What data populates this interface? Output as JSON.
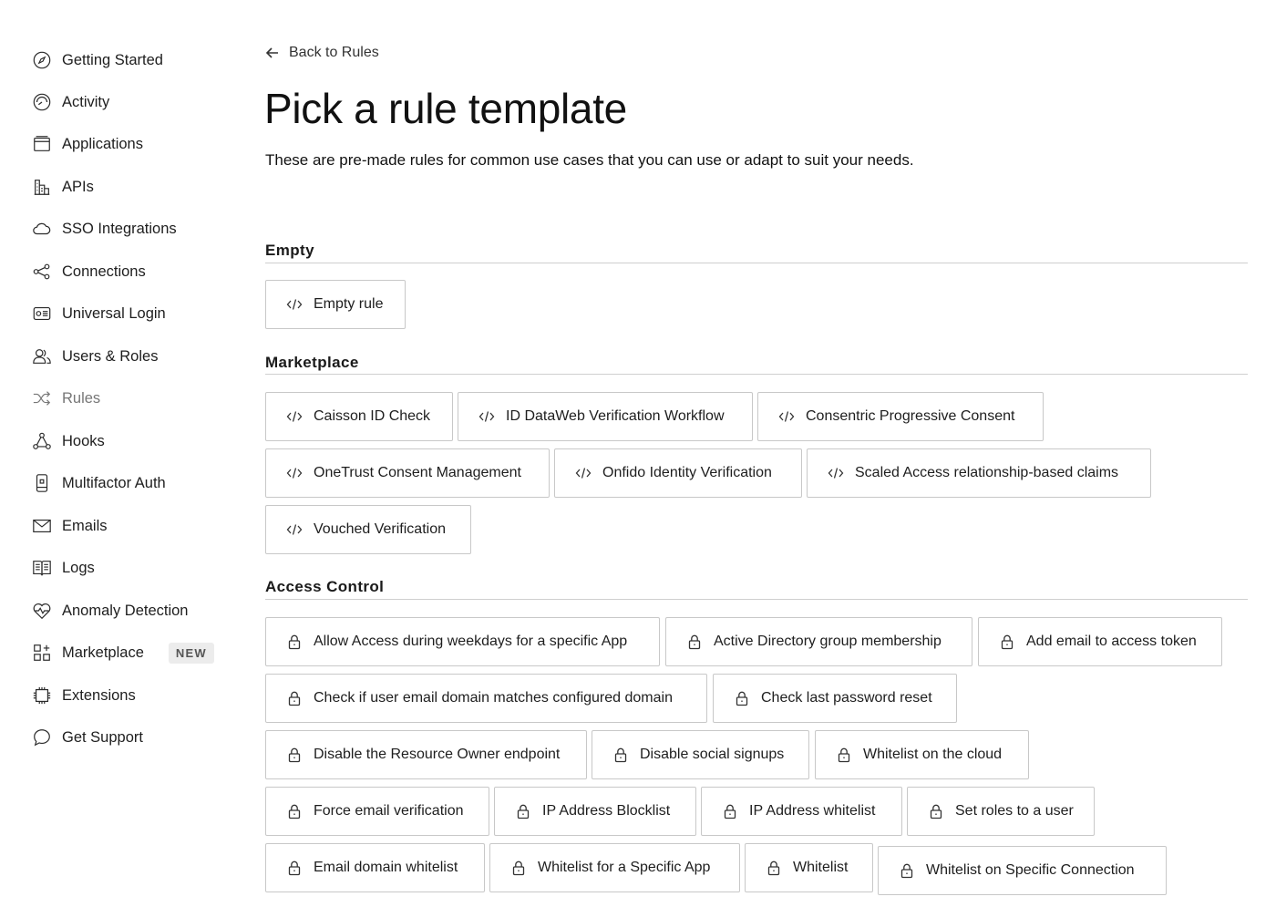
{
  "sidebar": {
    "items": [
      {
        "label": "Getting Started",
        "icon": "compass-icon"
      },
      {
        "label": "Activity",
        "icon": "activity-icon"
      },
      {
        "label": "Applications",
        "icon": "applications-icon"
      },
      {
        "label": "APIs",
        "icon": "apis-icon"
      },
      {
        "label": "SSO Integrations",
        "icon": "cloud-icon"
      },
      {
        "label": "Connections",
        "icon": "connections-icon"
      },
      {
        "label": "Universal Login",
        "icon": "universal-login-icon"
      },
      {
        "label": "Users & Roles",
        "icon": "users-icon"
      },
      {
        "label": "Rules",
        "icon": "shuffle-icon",
        "active": true
      },
      {
        "label": "Hooks",
        "icon": "hooks-icon"
      },
      {
        "label": "Multifactor Auth",
        "icon": "phone-icon"
      },
      {
        "label": "Emails",
        "icon": "mail-icon"
      },
      {
        "label": "Logs",
        "icon": "book-icon"
      },
      {
        "label": "Anomaly Detection",
        "icon": "heart-pulse-icon"
      },
      {
        "label": "Marketplace",
        "icon": "grid-icon",
        "badge": "NEW"
      },
      {
        "label": "Extensions",
        "icon": "chip-icon"
      },
      {
        "label": "Get Support",
        "icon": "chat-icon"
      }
    ]
  },
  "header": {
    "back_label": "Back to Rules",
    "title": "Pick a rule template",
    "description": "These are pre-made rules for common use cases that you can use or adapt to suit your needs."
  },
  "sections": {
    "empty": {
      "title": "Empty",
      "items": [
        "Empty rule"
      ]
    },
    "marketplace": {
      "title": "Marketplace",
      "items": [
        "Caisson ID Check",
        "ID DataWeb Verification Workflow",
        "Consentric Progressive Consent",
        "OneTrust Consent Management",
        "Onfido Identity Verification",
        "Scaled Access relationship-based claims",
        "Vouched Verification"
      ]
    },
    "access_control": {
      "title": "Access Control",
      "items": [
        "Allow Access during weekdays for a specific App",
        "Active Directory group membership",
        "Add email to access token",
        "Check if user email domain matches configured domain",
        "Check last password reset",
        "Disable the Resource Owner endpoint",
        "Disable social signups",
        "Whitelist on the cloud",
        "Force email verification",
        "IP Address Blocklist",
        "IP Address whitelist",
        "Set roles to a user",
        "Email domain whitelist",
        "Whitelist for a Specific App",
        "Whitelist",
        "Whitelist on Specific Connection"
      ]
    }
  },
  "icons": {
    "code_icon": "code-icon",
    "lock_icon": "lock-icon",
    "back_icon": "arrow-left-icon"
  }
}
